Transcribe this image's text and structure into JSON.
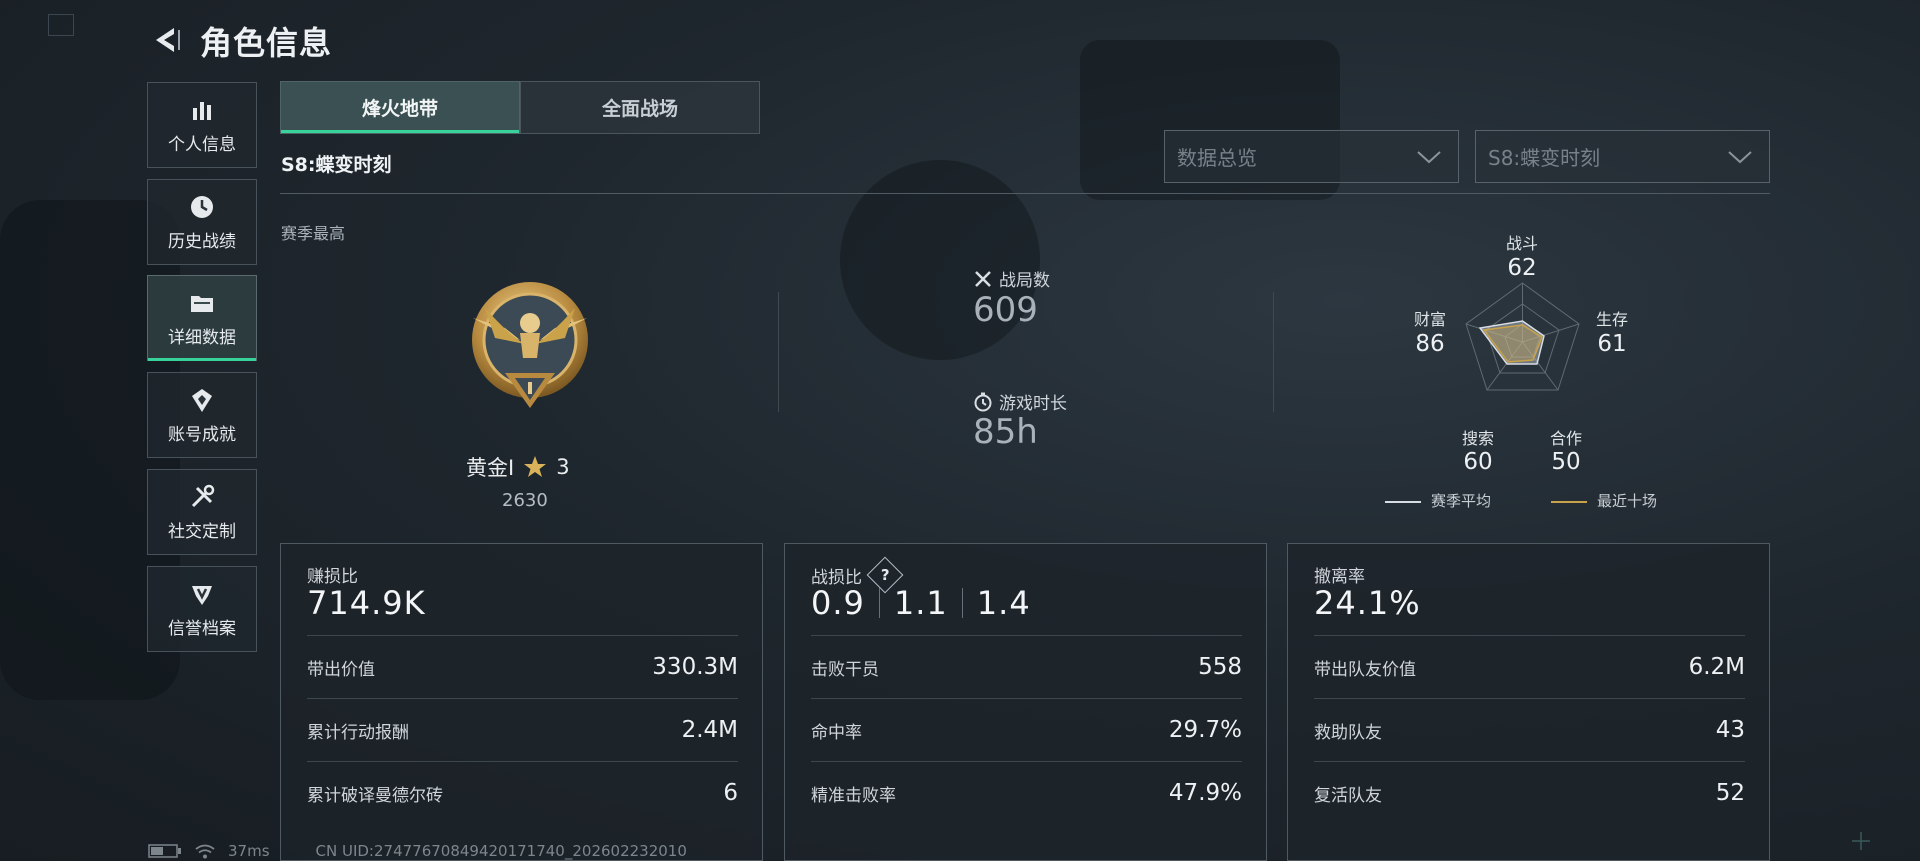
{
  "header": {
    "title": "角色信息"
  },
  "sidebar": {
    "items": [
      {
        "label": "个人信息",
        "icon": "bar-chart-icon"
      },
      {
        "label": "历史战绩",
        "icon": "clock-icon"
      },
      {
        "label": "详细数据",
        "icon": "folder-icon",
        "active": true
      },
      {
        "label": "账号成就",
        "icon": "achievement-icon"
      },
      {
        "label": "社交定制",
        "icon": "tools-icon"
      },
      {
        "label": "信誉档案",
        "icon": "shield-emblem-icon"
      }
    ]
  },
  "tabs": [
    {
      "label": "烽火地带",
      "active": true
    },
    {
      "label": "全面战场",
      "active": false
    }
  ],
  "season_title": "S8:蝶变时刻",
  "dropdowns": {
    "data_overview": "数据总览",
    "season": "S8:蝶变时刻"
  },
  "season_best": {
    "label": "赛季最高",
    "rank_name": "黄金I",
    "stars": "3",
    "score": "2630"
  },
  "overview": {
    "matches_label": "战局数",
    "matches_value": "609",
    "playtime_label": "游戏时长",
    "playtime_value": "85h"
  },
  "radar": {
    "combat": {
      "label": "战斗",
      "value": "62"
    },
    "survival": {
      "label": "生存",
      "value": "61"
    },
    "cooperation": {
      "label": "合作",
      "value": "50"
    },
    "search": {
      "label": "搜索",
      "value": "60"
    },
    "wealth": {
      "label": "财富",
      "value": "86"
    },
    "legend_season": "赛季平均",
    "legend_recent": "最近十场",
    "color_season": "#d7dde2",
    "color_recent": "#c9a24a"
  },
  "cards": {
    "profit": {
      "label": "赚损比",
      "value": "714.9K",
      "rows": [
        {
          "k": "带出价值",
          "v": "330.3M"
        },
        {
          "k": "累计行动报酬",
          "v": "2.4M"
        },
        {
          "k": "累计破译曼德尔砖",
          "v": "6"
        }
      ]
    },
    "combat": {
      "label": "战损比",
      "help": "?",
      "values": [
        "0.9",
        "1.1",
        "1.4"
      ],
      "rows": [
        {
          "k": "击败干员",
          "v": "558"
        },
        {
          "k": "命中率",
          "v": "29.7%"
        },
        {
          "k": "精准击败率",
          "v": "47.9%"
        }
      ]
    },
    "extract": {
      "label": "撤离率",
      "value": "24.1%",
      "rows": [
        {
          "k": "带出队友价值",
          "v": "6.2M"
        },
        {
          "k": "救助队友",
          "v": "43"
        },
        {
          "k": "复活队友",
          "v": "52"
        }
      ]
    }
  },
  "footer": {
    "ping": "37ms",
    "uid": "CN UID:2747767084942017174​0_202602232010"
  },
  "colors": {
    "accent": "#38d39a",
    "gold": "#c9a24a"
  }
}
